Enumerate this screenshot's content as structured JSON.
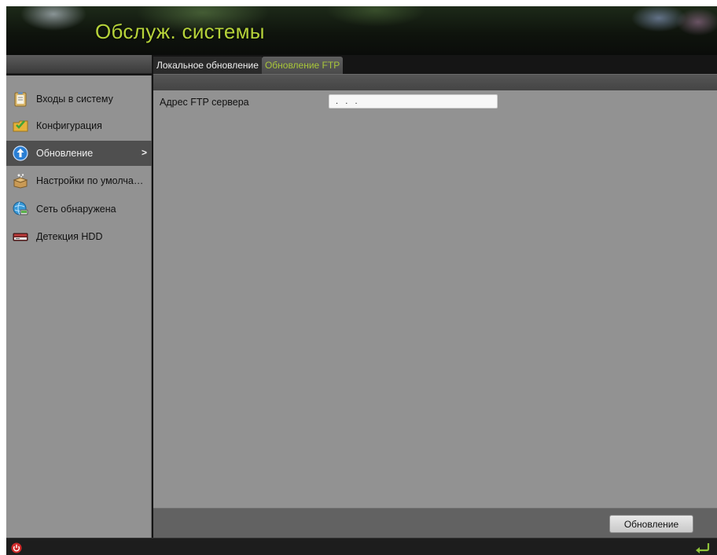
{
  "header": {
    "title": "Обслуж. системы"
  },
  "tabs": [
    {
      "label": "Локальное обновление",
      "active": false
    },
    {
      "label": "Обновление FTP",
      "active": true
    }
  ],
  "sidebar": {
    "items": [
      {
        "label": "Входы в систему",
        "icon": "clipboard-icon",
        "active": false
      },
      {
        "label": "Конфигурация",
        "icon": "folder-check-icon",
        "active": false
      },
      {
        "label": "Обновление",
        "icon": "upload-arrow-icon",
        "active": true,
        "chevron": ">"
      },
      {
        "label": "Настройки по умолчанию",
        "icon": "box-sparkle-icon",
        "active": false
      },
      {
        "label": "Сеть обнаружена",
        "icon": "globe-network-icon",
        "active": false
      },
      {
        "label": "Детекция HDD",
        "icon": "hard-drive-icon",
        "active": false
      }
    ]
  },
  "main": {
    "ftp_label": "Адрес FTP сервера",
    "ftp_value": ".   .   .",
    "update_button": "Обновление"
  },
  "statusbar": {
    "power_icon": "power-icon",
    "back_icon": "back-arrow-icon"
  },
  "colors": {
    "accent": "#a8c63a",
    "title": "#b6d33a",
    "panel": "#929292",
    "active_item": "#4f4f4f"
  }
}
